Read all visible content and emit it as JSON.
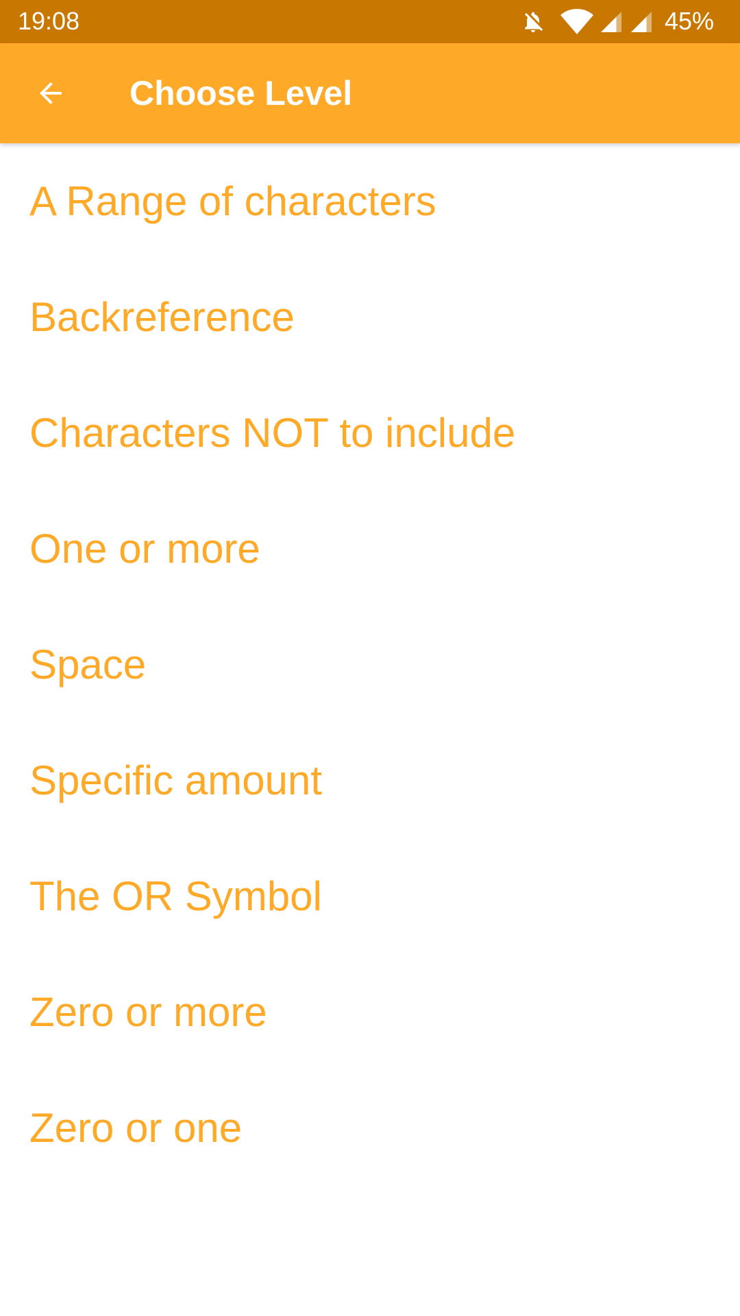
{
  "status_bar": {
    "time": "19:08",
    "battery": "45%",
    "icons": [
      "bell-off-icon",
      "wifi-icon",
      "signal-icon",
      "signal-icon"
    ]
  },
  "app_bar": {
    "back_icon": "arrow-left-icon",
    "title": "Choose Level"
  },
  "levels": [
    {
      "label": "A Range of characters"
    },
    {
      "label": "Backreference"
    },
    {
      "label": "Characters NOT to include"
    },
    {
      "label": "One or more"
    },
    {
      "label": "Space"
    },
    {
      "label": "Specific amount"
    },
    {
      "label": "The OR Symbol"
    },
    {
      "label": "Zero or more"
    },
    {
      "label": "Zero or one"
    }
  ],
  "colors": {
    "status_bar": "#c87700",
    "app_bar": "#ffa929",
    "accent_text": "#ffa929",
    "background": "#ffffff"
  }
}
